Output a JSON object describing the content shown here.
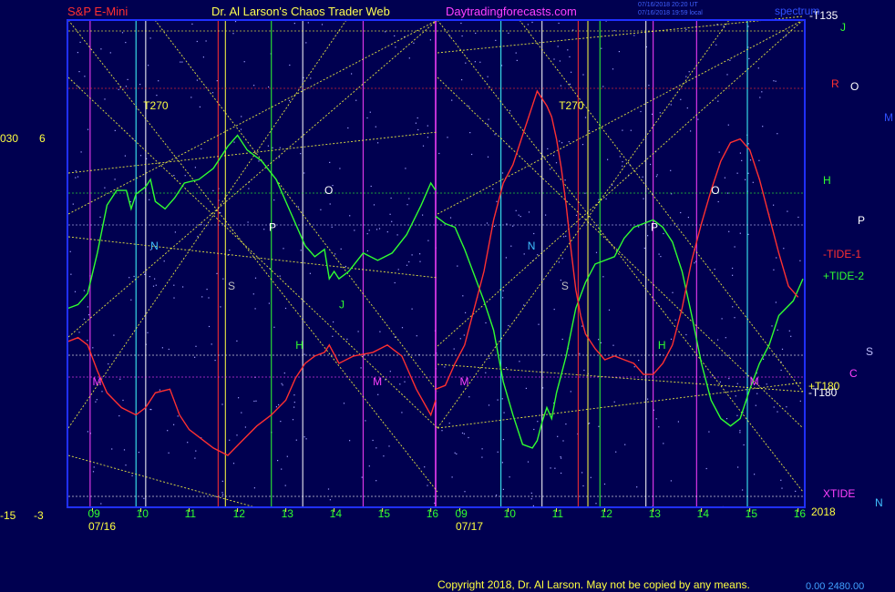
{
  "header": {
    "left": "S&P E-Mini",
    "center": "Dr. Al Larson's Chaos Trader Web",
    "right": "Daytradingforecasts.com",
    "stamp_1": "07/16/2018 20:20 UT",
    "stamp_2": "07/16/2018 19:59 local",
    "top_right": "spectrum",
    "colors": {
      "left": "#ff3030",
      "center": "#ffff50",
      "right": "#ff40ff"
    }
  },
  "copyright": "Copyright 2018, Dr. Al Larson. May not be copied by any means.",
  "corner_label": "0.00  2480.00",
  "left_scale": [
    "030",
    "6",
    "-15",
    "-3"
  ],
  "chart_data": {
    "type": "line",
    "title": "S&P E-Mini",
    "x_unit": "hour",
    "x_ticks": [
      {
        "day": 0,
        "hour": 9,
        "label": "09"
      },
      {
        "day": 0,
        "hour": 10,
        "label": "10"
      },
      {
        "day": 0,
        "hour": 11,
        "label": "11"
      },
      {
        "day": 0,
        "hour": 12,
        "label": "12"
      },
      {
        "day": 0,
        "hour": 13,
        "label": "13"
      },
      {
        "day": 0,
        "hour": 14,
        "label": "14"
      },
      {
        "day": 0,
        "hour": 15,
        "label": "15"
      },
      {
        "day": 0,
        "hour": 16,
        "label": "16"
      },
      {
        "day": 1,
        "hour": 9,
        "label": "09"
      },
      {
        "day": 1,
        "hour": 10,
        "label": "10"
      },
      {
        "day": 1,
        "hour": 11,
        "label": "11"
      },
      {
        "day": 1,
        "hour": 12,
        "label": "12"
      },
      {
        "day": 1,
        "hour": 13,
        "label": "13"
      },
      {
        "day": 1,
        "hour": 14,
        "label": "14"
      },
      {
        "day": 1,
        "hour": 15,
        "label": "15"
      },
      {
        "day": 1,
        "hour": 16,
        "label": "16"
      }
    ],
    "date_labels": [
      "07/16",
      "07/17"
    ],
    "year_label": "2018",
    "hour_range": [
      8.5,
      16.1
    ],
    "y_range": [
      0,
      100
    ],
    "series": [
      {
        "name": "+TIDE-2",
        "color": "#30ff30",
        "sessions": [
          [
            [
              8.5,
              40
            ],
            [
              8.7,
              41
            ],
            [
              8.9,
              44
            ],
            [
              9.1,
              55
            ],
            [
              9.3,
              68
            ],
            [
              9.5,
              72
            ],
            [
              9.7,
              72
            ],
            [
              9.8,
              67
            ],
            [
              9.9,
              71
            ],
            [
              10.0,
              72
            ],
            [
              10.1,
              73
            ],
            [
              10.2,
              75
            ],
            [
              10.3,
              69
            ],
            [
              10.5,
              67
            ],
            [
              10.7,
              70
            ],
            [
              10.9,
              74
            ],
            [
              11.2,
              75
            ],
            [
              11.5,
              78
            ],
            [
              11.8,
              84
            ],
            [
              12.0,
              87
            ],
            [
              12.2,
              83
            ],
            [
              12.5,
              80
            ],
            [
              12.8,
              75
            ],
            [
              13.1,
              66
            ],
            [
              13.4,
              57
            ],
            [
              13.6,
              54
            ],
            [
              13.8,
              56
            ],
            [
              13.9,
              48
            ],
            [
              14.0,
              50
            ],
            [
              14.1,
              48
            ],
            [
              14.3,
              50
            ],
            [
              14.6,
              55
            ],
            [
              14.9,
              53
            ],
            [
              15.2,
              55
            ],
            [
              15.5,
              60
            ],
            [
              15.8,
              68
            ],
            [
              16.0,
              74
            ],
            [
              16.1,
              72
            ]
          ],
          [
            [
              8.5,
              65
            ],
            [
              8.7,
              63
            ],
            [
              8.9,
              62
            ],
            [
              9.1,
              56
            ],
            [
              9.3,
              49
            ],
            [
              9.5,
              42
            ],
            [
              9.7,
              34
            ],
            [
              9.9,
              20
            ],
            [
              10.1,
              11
            ],
            [
              10.3,
              3
            ],
            [
              10.5,
              2
            ],
            [
              10.6,
              4
            ],
            [
              10.7,
              9
            ],
            [
              10.8,
              13
            ],
            [
              10.9,
              10
            ],
            [
              11.0,
              17
            ],
            [
              11.1,
              22
            ],
            [
              11.2,
              27
            ],
            [
              11.4,
              40
            ],
            [
              11.6,
              47
            ],
            [
              11.8,
              52
            ],
            [
              12.0,
              53
            ],
            [
              12.2,
              54
            ],
            [
              12.4,
              59
            ],
            [
              12.6,
              62
            ],
            [
              12.8,
              63
            ],
            [
              13.0,
              64
            ],
            [
              13.2,
              62
            ],
            [
              13.4,
              58
            ],
            [
              13.6,
              50
            ],
            [
              13.8,
              38
            ],
            [
              14.0,
              25
            ],
            [
              14.2,
              15
            ],
            [
              14.4,
              10
            ],
            [
              14.6,
              8
            ],
            [
              14.8,
              10
            ],
            [
              15.0,
              18
            ],
            [
              15.2,
              25
            ],
            [
              15.4,
              30
            ],
            [
              15.6,
              38
            ],
            [
              15.9,
              42
            ],
            [
              16.1,
              48
            ]
          ]
        ]
      },
      {
        "name": "-TIDE-1",
        "color": "#ff3030",
        "sessions": [
          [
            [
              8.5,
              31
            ],
            [
              8.7,
              32
            ],
            [
              8.9,
              30
            ],
            [
              9.1,
              23
            ],
            [
              9.3,
              17
            ],
            [
              9.6,
              13
            ],
            [
              9.9,
              11
            ],
            [
              10.1,
              13
            ],
            [
              10.3,
              17
            ],
            [
              10.6,
              18
            ],
            [
              10.8,
              11
            ],
            [
              11.0,
              7
            ],
            [
              11.3,
              4
            ],
            [
              11.5,
              2
            ],
            [
              11.8,
              0
            ],
            [
              12.1,
              4
            ],
            [
              12.4,
              8
            ],
            [
              12.7,
              11
            ],
            [
              13.0,
              15
            ],
            [
              13.2,
              21
            ],
            [
              13.4,
              25
            ],
            [
              13.6,
              27
            ],
            [
              13.8,
              28
            ],
            [
              13.9,
              30
            ],
            [
              14.1,
              25
            ],
            [
              14.4,
              27
            ],
            [
              14.8,
              28
            ],
            [
              15.1,
              30
            ],
            [
              15.4,
              27
            ],
            [
              15.7,
              18
            ],
            [
              16.0,
              11
            ],
            [
              16.1,
              15
            ]
          ],
          [
            [
              8.5,
              18
            ],
            [
              8.7,
              19
            ],
            [
              8.9,
              25
            ],
            [
              9.1,
              30
            ],
            [
              9.3,
              40
            ],
            [
              9.5,
              50
            ],
            [
              9.7,
              64
            ],
            [
              9.9,
              74
            ],
            [
              10.1,
              79
            ],
            [
              10.3,
              87
            ],
            [
              10.5,
              95
            ],
            [
              10.6,
              99
            ],
            [
              10.7,
              97
            ],
            [
              10.8,
              95
            ],
            [
              10.9,
              92
            ],
            [
              11.0,
              86
            ],
            [
              11.1,
              78
            ],
            [
              11.2,
              68
            ],
            [
              11.3,
              56
            ],
            [
              11.4,
              45
            ],
            [
              11.5,
              38
            ],
            [
              11.6,
              33
            ],
            [
              11.8,
              29
            ],
            [
              12.0,
              26
            ],
            [
              12.2,
              27
            ],
            [
              12.4,
              26
            ],
            [
              12.6,
              25
            ],
            [
              12.8,
              22
            ],
            [
              13.0,
              22
            ],
            [
              13.2,
              25
            ],
            [
              13.4,
              30
            ],
            [
              13.6,
              40
            ],
            [
              13.8,
              53
            ],
            [
              14.0,
              63
            ],
            [
              14.2,
              72
            ],
            [
              14.4,
              80
            ],
            [
              14.6,
              85
            ],
            [
              14.8,
              86
            ],
            [
              15.0,
              83
            ],
            [
              15.2,
              75
            ],
            [
              15.4,
              65
            ],
            [
              15.6,
              55
            ],
            [
              15.8,
              46
            ],
            [
              16.0,
              43
            ]
          ]
        ]
      },
      {
        "name": "XTIDE",
        "color": "#ff40ff",
        "sessions": []
      }
    ],
    "annotations": [
      {
        "text": "T270",
        "color": "#ffff40",
        "day": 0,
        "hour": 10.05,
        "y": 94
      },
      {
        "text": "T270",
        "color": "#ffff40",
        "day": 1,
        "hour": 11.05,
        "y": 94
      },
      {
        "text": "N",
        "color": "#40c0ff",
        "day": 0,
        "hour": 10.2,
        "y": 56
      },
      {
        "text": "N",
        "color": "#40c0ff",
        "day": 1,
        "hour": 10.4,
        "y": 56
      },
      {
        "text": "S",
        "color": "#c0c0c0",
        "day": 0,
        "hour": 11.8,
        "y": 45
      },
      {
        "text": "S",
        "color": "#c0c0c0",
        "day": 1,
        "hour": 11.1,
        "y": 45
      },
      {
        "text": "P",
        "color": "#ffffff",
        "day": 0,
        "hour": 12.65,
        "y": 61
      },
      {
        "text": "P",
        "color": "#ffffff",
        "day": 1,
        "hour": 12.95,
        "y": 61
      },
      {
        "text": "O",
        "color": "#ffffff",
        "day": 0,
        "hour": 13.8,
        "y": 71
      },
      {
        "text": "O",
        "color": "#ffffff",
        "day": 1,
        "hour": 14.2,
        "y": 71
      },
      {
        "text": "H",
        "color": "#30ff30",
        "day": 0,
        "hour": 13.2,
        "y": 29
      },
      {
        "text": "H",
        "color": "#30ff30",
        "day": 1,
        "hour": 13.1,
        "y": 29
      },
      {
        "text": "J",
        "color": "#30ff30",
        "day": 0,
        "hour": 14.1,
        "y": 40
      },
      {
        "text": "M",
        "color": "#ff40ff",
        "day": 0,
        "hour": 9.0,
        "y": 19
      },
      {
        "text": "M",
        "color": "#ff40ff",
        "day": 0,
        "hour": 14.8,
        "y": 19
      },
      {
        "text": "M",
        "color": "#ff40ff",
        "day": 1,
        "hour": 9.0,
        "y": 19
      },
      {
        "text": "M",
        "color": "#ff40ff",
        "day": 1,
        "hour": 15.0,
        "y": 19
      }
    ],
    "right_labels": [
      {
        "text": "-T135",
        "color": "#ffffff"
      },
      {
        "text": "J",
        "color": "#30ff30"
      },
      {
        "text": "R",
        "color": "#ff3030"
      },
      {
        "text": "O",
        "color": "#ffffff"
      },
      {
        "text": "M",
        "color": "#3050ff"
      },
      {
        "text": "H",
        "color": "#30ff30"
      },
      {
        "text": "P",
        "color": "#ffffff"
      },
      {
        "text": "-TIDE-1",
        "color": "#ff3030"
      },
      {
        "text": "+TIDE-2",
        "color": "#30ff30"
      },
      {
        "text": "S",
        "color": "#c0c0ff"
      },
      {
        "text": "C",
        "color": "#ff40ff"
      },
      {
        "text": "+T180",
        "color": "#ffff40"
      },
      {
        "text": "-T180",
        "color": "#ffffff"
      },
      {
        "text": "XTIDE",
        "color": "#ff40ff"
      },
      {
        "text": "N",
        "color": "#40c0ff"
      }
    ],
    "grid": true,
    "background": "#000050"
  }
}
